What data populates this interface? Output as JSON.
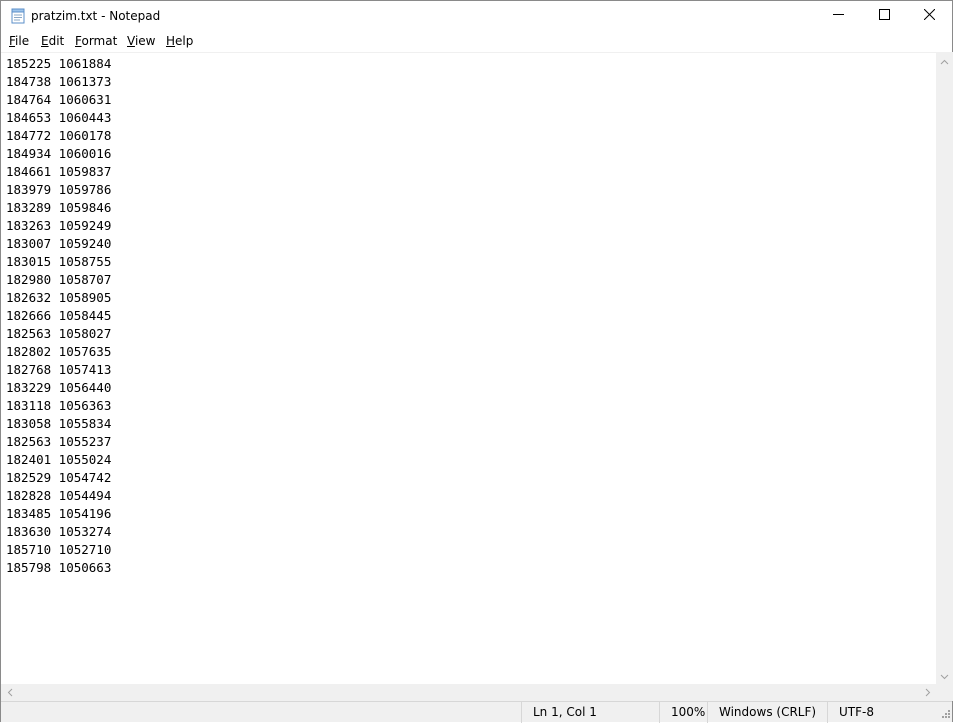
{
  "window": {
    "title": "pratzim.txt - Notepad"
  },
  "icons": {
    "app": "notepad-icon",
    "minimize": "minimize-icon",
    "maximize": "maximize-icon",
    "close": "close-icon"
  },
  "menu": {
    "file": {
      "mnemonic": "F",
      "rest": "ile"
    },
    "edit": {
      "mnemonic": "E",
      "rest": "dit"
    },
    "format": {
      "mnemonic": "F",
      "rest": "ormat"
    },
    "view": {
      "mnemonic": "V",
      "rest": "iew"
    },
    "help": {
      "mnemonic": "H",
      "rest": "elp"
    }
  },
  "document": {
    "lines": [
      "185225 1061884",
      "184738 1061373",
      "184764 1060631",
      "184653 1060443",
      "184772 1060178",
      "184934 1060016",
      "184661 1059837",
      "183979 1059786",
      "183289 1059846",
      "183263 1059249",
      "183007 1059240",
      "183015 1058755",
      "182980 1058707",
      "182632 1058905",
      "182666 1058445",
      "182563 1058027",
      "182802 1057635",
      "182768 1057413",
      "183229 1056440",
      "183118 1056363",
      "183058 1055834",
      "182563 1055237",
      "182401 1055024",
      "182529 1054742",
      "182828 1054494",
      "183485 1054196",
      "183630 1053274",
      "185710 1052710",
      "185798 1050663"
    ]
  },
  "status": {
    "position": "Ln 1, Col 1",
    "zoom": "100%",
    "line_ending": "Windows (CRLF)",
    "encoding": "UTF-8"
  }
}
